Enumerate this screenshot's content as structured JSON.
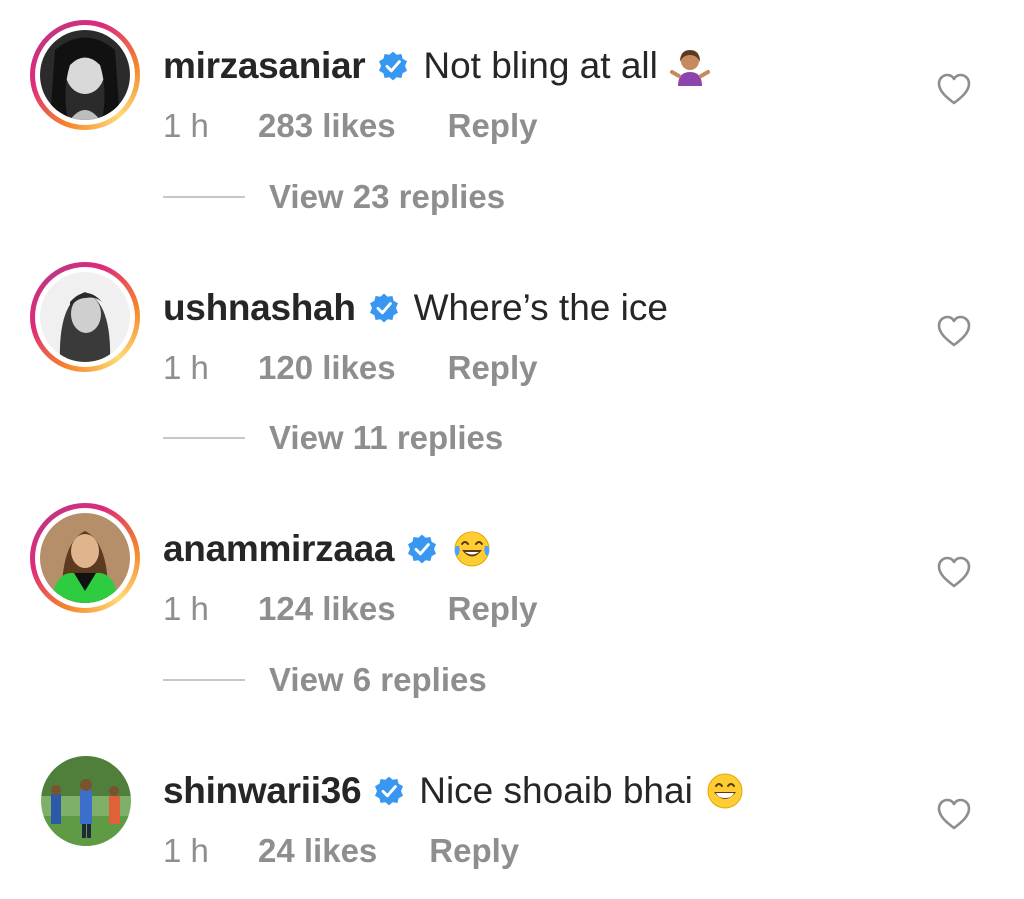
{
  "comments": [
    {
      "username": "mirzasaniar",
      "text": "Not bling at all",
      "time": "1 h",
      "likes": "283 likes",
      "reply_label": "Reply",
      "view_replies": "View 23 replies",
      "emoji": "person-shrugging-emoji",
      "has_story_ring": true
    },
    {
      "username": "ushnashah",
      "text": "Where’s the ice",
      "time": "1 h",
      "likes": "120 likes",
      "reply_label": "Reply",
      "view_replies": "View 11 replies",
      "has_story_ring": true
    },
    {
      "username": "anammirzaaa",
      "text": "",
      "time": "1 h",
      "likes": "124 likes",
      "reply_label": "Reply",
      "view_replies": "View 6 replies",
      "emoji": "tears-of-joy-emoji",
      "has_story_ring": true
    },
    {
      "username": "shinwarii36",
      "text": "Nice shoaib bhai",
      "time": "1 h",
      "likes": "24 likes",
      "reply_label": "Reply",
      "emoji": "grinning-face-emoji",
      "has_story_ring": false
    }
  ],
  "colors": {
    "username": "#262626",
    "meta": "#8e8e8e",
    "verified_badge": "#3897f0",
    "ring_start": "#f58529",
    "ring_end": "#dd2a7b"
  },
  "icons": {
    "verified": "verified-badge-icon",
    "like": "heart-outline-icon"
  }
}
